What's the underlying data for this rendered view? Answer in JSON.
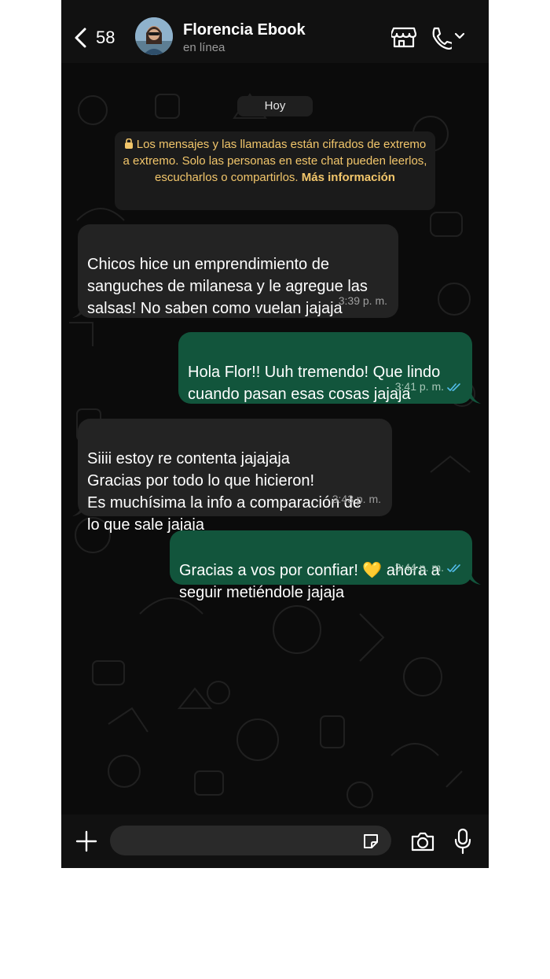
{
  "header": {
    "back_count": "58",
    "contact_name": "Florencia Ebook",
    "status": "en línea"
  },
  "chat": {
    "date_label": "Hoy",
    "encryption_notice": "Los mensajes y las llamadas están cifrados de extremo a extremo. Solo las personas en este chat pueden leerlos, escucharlos o compartirlos.",
    "encryption_link": "Más información",
    "messages": [
      {
        "direction": "in",
        "text": "Chicos hice un emprendimiento de\nsanguches de milanesa y le agregue las\nsalsas! No saben como vuelan jajaja",
        "time": "3:39 p. m."
      },
      {
        "direction": "out",
        "text": "Hola Flor!! Uuh tremendo! Que lindo\ncuando pasan esas cosas jajaja",
        "time": "3:41 p. m.",
        "status": "read"
      },
      {
        "direction": "in",
        "text": "Siiii estoy re contenta jajajaja\nGracias por todo lo que hicieron!\nEs muchísima la info a comparación de\nlo que sale jajaja",
        "time": "3:43 p. m."
      },
      {
        "direction": "out",
        "text": "Gracias a vos por confiar! 💛 ahora a\nseguir metiéndole jajaja",
        "time": "3:44 p. m.",
        "status": "read"
      }
    ]
  },
  "input": {
    "placeholder": ""
  },
  "icons": {
    "back": "chevron-left-icon",
    "catalog": "storefront-icon",
    "call": "phone-icon",
    "call_menu": "chevron-down-icon",
    "attach": "plus-icon",
    "sticker": "sticker-icon",
    "camera": "camera-icon",
    "mic": "microphone-icon",
    "lock": "lock-icon",
    "read_receipt": "double-check-icon"
  },
  "colors": {
    "incoming_bubble": "#232323",
    "outgoing_bubble": "#12553c",
    "notice_text": "#f2c66b",
    "read_ticks": "#53bdeb"
  }
}
